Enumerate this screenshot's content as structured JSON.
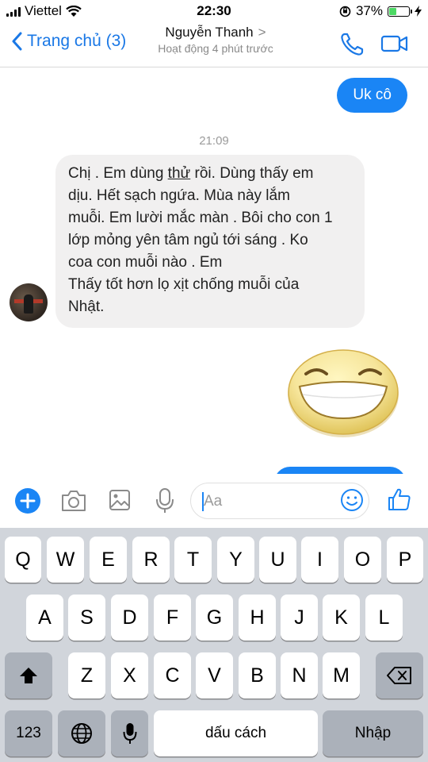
{
  "status_bar": {
    "carrier": "Viettel",
    "time": "22:30",
    "battery": "37%",
    "battery_level": 0.37
  },
  "header": {
    "back_label": "Trang chủ (3)",
    "contact_name": "Nguyễn Thanh",
    "contact_name_chevron": ">",
    "contact_status": "Hoạt động 4 phút trước",
    "call_icon": "phone-icon",
    "video_icon": "video-camera-icon",
    "accent_color": "#1a78e6"
  },
  "chat": {
    "outgoing_message": "Uk cô",
    "timestamp": "21:09",
    "incoming_message": {
      "line1_before": "Chị . Em dùng ",
      "line1_underlined": "thử",
      "line1_after": " rồi. Dùng thấy em",
      "lines": [
        "dịu. Hết sạch ngứa. Mùa này lắm",
        "muỗi. Em lười mắc màn . Bôi cho con 1",
        "lớp mỏng yên tâm ngủ tới sáng . Ko",
        "coa con muỗi nào . Em",
        "Thấy tốt hơn lọ xịt chống muỗi của",
        "Nhật."
      ]
    },
    "sticker": "laughing-face-sticker",
    "bubble_out_color": "#1a85f5",
    "bubble_in_color": "#f1f0f0"
  },
  "composer": {
    "placeholder": "Aa",
    "icons": [
      "plus-icon",
      "camera-icon",
      "image-icon",
      "microphone-icon",
      "emoji-icon",
      "thumbs-up-icon"
    ]
  },
  "keyboard": {
    "row1": [
      "Q",
      "W",
      "E",
      "R",
      "T",
      "Y",
      "U",
      "I",
      "O",
      "P"
    ],
    "row2": [
      "A",
      "S",
      "D",
      "F",
      "G",
      "H",
      "J",
      "K",
      "L"
    ],
    "row3": [
      "Z",
      "X",
      "C",
      "V",
      "B",
      "N",
      "M"
    ],
    "numbers_key": "123",
    "space_label": "dấu cách",
    "return_label": "Nhập"
  }
}
